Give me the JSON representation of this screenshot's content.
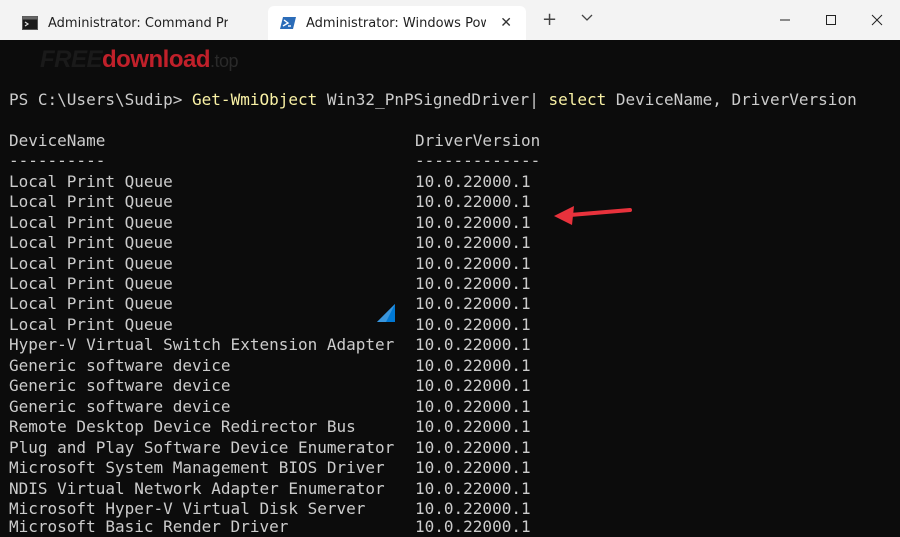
{
  "tabs": [
    {
      "label": "Administrator: Command Prompt",
      "active": false,
      "icon": "cmd-icon"
    },
    {
      "label": "Administrator: Windows PowerShell",
      "active": true,
      "icon": "powershell-icon"
    }
  ],
  "titlebar": {
    "new_tab": "+",
    "close_tab": "✕"
  },
  "watermark": {
    "part1": "FREE",
    "part2": "download",
    "part3": ".top"
  },
  "terminal": {
    "prompt": "PS C:\\Users\\Sudip> ",
    "command_name": "Get-WmiObject",
    "command_args": " Win32_PnPSignedDriver",
    "pipe": "| ",
    "select_kw": "select",
    "select_args": " DeviceName, DriverVersion",
    "headers": [
      "DeviceName",
      "DriverVersion"
    ],
    "underlines": [
      "----------",
      "-------------"
    ],
    "rows": [
      [
        "Local Print Queue",
        "10.0.22000.1"
      ],
      [
        "Local Print Queue",
        "10.0.22000.1"
      ],
      [
        "Local Print Queue",
        "10.0.22000.1"
      ],
      [
        "Local Print Queue",
        "10.0.22000.1"
      ],
      [
        "Local Print Queue",
        "10.0.22000.1"
      ],
      [
        "Local Print Queue",
        "10.0.22000.1"
      ],
      [
        "Local Print Queue",
        "10.0.22000.1"
      ],
      [
        "Local Print Queue",
        "10.0.22000.1"
      ],
      [
        "Hyper-V Virtual Switch Extension Adapter",
        "10.0.22000.1"
      ],
      [
        "Generic software device",
        "10.0.22000.1"
      ],
      [
        "Generic software device",
        "10.0.22000.1"
      ],
      [
        "Generic software device",
        "10.0.22000.1"
      ],
      [
        "Remote Desktop Device Redirector Bus",
        "10.0.22000.1"
      ],
      [
        "Plug and Play Software Device Enumerator",
        "10.0.22000.1"
      ],
      [
        "Microsoft System Management BIOS Driver",
        "10.0.22000.1"
      ],
      [
        "NDIS Virtual Network Adapter Enumerator",
        "10.0.22000.1"
      ],
      [
        "Microsoft Hyper-V Virtual Disk Server",
        "10.0.22000.1"
      ],
      [
        "Microsoft Basic Render Driver",
        "10.0.22000.1"
      ]
    ]
  },
  "colors": {
    "terminal_bg": "#0c0c0c",
    "text": "#cccccc",
    "command": "#f9f1a5",
    "annotation_arrow": "#e8323c"
  },
  "icons": [
    "cmd-icon",
    "powershell-icon",
    "close-icon",
    "plus-icon",
    "chevron-down-icon",
    "minimize-icon",
    "maximize-icon",
    "window-close-icon",
    "red-arrow-icon",
    "windows-logo-icon"
  ]
}
